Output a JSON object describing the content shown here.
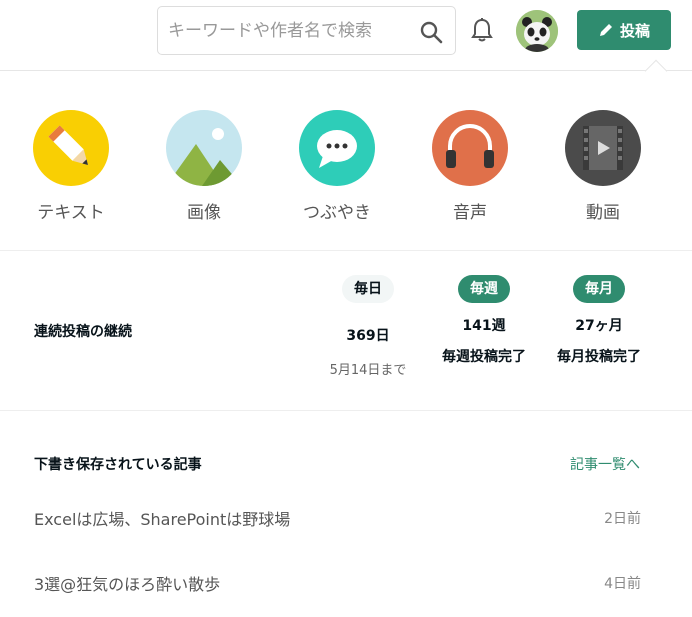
{
  "header": {
    "search_placeholder": "キーワードや作者名で検索",
    "post_button_label": "投稿"
  },
  "post_types": [
    {
      "label": "テキスト",
      "icon": "pencil-icon",
      "color": "#f9cf03"
    },
    {
      "label": "画像",
      "icon": "image-icon",
      "color": "#c5e6ef"
    },
    {
      "label": "つぶやき",
      "icon": "chat-bubble-icon",
      "color": "#2ecdb8"
    },
    {
      "label": "音声",
      "icon": "headphones-icon",
      "color": "#e0704a"
    },
    {
      "label": "動画",
      "icon": "video-icon",
      "color": "#4b4b4b"
    }
  ],
  "streak": {
    "title": "連続投稿の継続",
    "daily": {
      "badge": "毎日",
      "count": "369日",
      "sub": "5月14日まで"
    },
    "weekly": {
      "badge": "毎週",
      "count": "141週",
      "status": "毎週投稿完了"
    },
    "monthly": {
      "badge": "毎月",
      "count": "27ヶ月",
      "status": "毎月投稿完了"
    }
  },
  "drafts": {
    "title": "下書き保存されている記事",
    "link": "記事一覧へ",
    "items": [
      {
        "title": "Excelは広場、SharePointは野球場",
        "time": "2日前"
      },
      {
        "title": "3選@狂気のほろ酔い散歩",
        "time": "4日前"
      }
    ]
  },
  "colors": {
    "accent": "#2f8c6f"
  }
}
